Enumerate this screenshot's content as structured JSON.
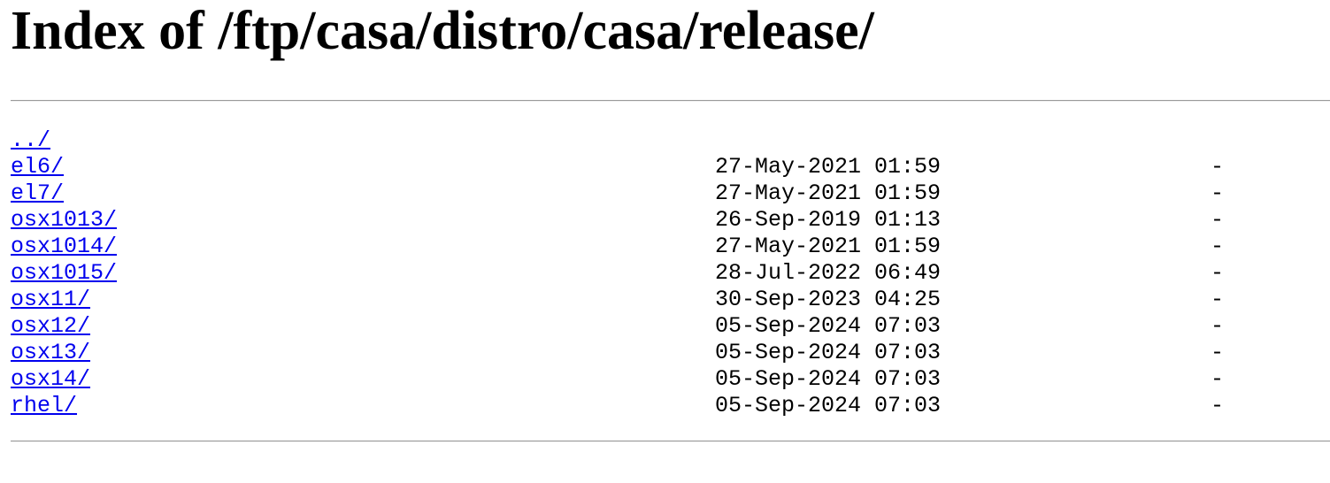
{
  "page": {
    "title": "Index of /ftp/casa/distro/casa/release/"
  },
  "listing": [
    {
      "name": "../",
      "date": "",
      "size": ""
    },
    {
      "name": "el6/",
      "date": "27-May-2021 01:59",
      "size": "-"
    },
    {
      "name": "el7/",
      "date": "27-May-2021 01:59",
      "size": "-"
    },
    {
      "name": "osx1013/",
      "date": "26-Sep-2019 01:13",
      "size": "-"
    },
    {
      "name": "osx1014/",
      "date": "27-May-2021 01:59",
      "size": "-"
    },
    {
      "name": "osx1015/",
      "date": "28-Jul-2022 06:49",
      "size": "-"
    },
    {
      "name": "osx11/",
      "date": "30-Sep-2023 04:25",
      "size": "-"
    },
    {
      "name": "osx12/",
      "date": "05-Sep-2024 07:03",
      "size": "-"
    },
    {
      "name": "osx13/",
      "date": "05-Sep-2024 07:03",
      "size": "-"
    },
    {
      "name": "osx14/",
      "date": "05-Sep-2024 07:03",
      "size": "-"
    },
    {
      "name": "rhel/",
      "date": "05-Sep-2024 07:03",
      "size": "-"
    }
  ],
  "colors": {
    "link": "#0000ee",
    "text": "#000000",
    "background": "#ffffff"
  }
}
